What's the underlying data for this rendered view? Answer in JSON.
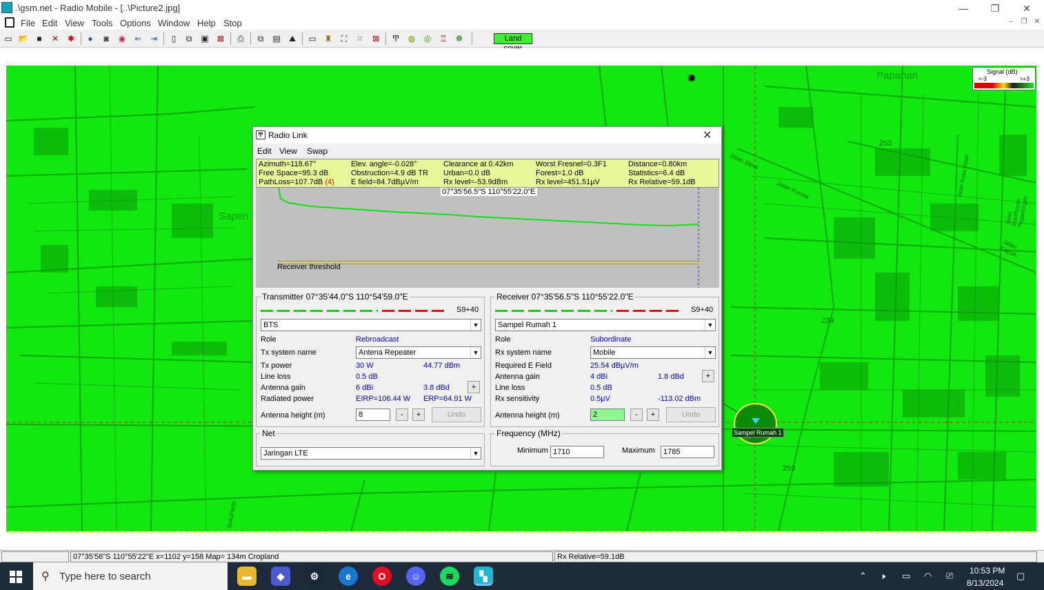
{
  "window": {
    "title": ".\\gsm.net - Radio Mobile - [..\\Picture2.jpg]",
    "controls": [
      "—",
      "❐",
      "✕"
    ]
  },
  "menubar": {
    "items": [
      "File",
      "Edit",
      "View",
      "Tools",
      "Options",
      "Window",
      "Help",
      "Stop"
    ],
    "mdi_controls": [
      "–",
      "❐",
      "✕"
    ]
  },
  "toolbar": {
    "land_cover_label": "Land cover"
  },
  "map": {
    "labels": {
      "papahan": "Papahan",
      "sapen": "Sapen",
      "jalan_bima": "Jalan Bima",
      "jalan_kurma": "Jalan Kurma",
      "jalan_nusa_indah": "Jalan Nusa Indah",
      "jalan_elamboyan": "Jalan Elamboyan Pegadungan",
      "jalan_kapuk": "Jalan Kapuk",
      "sukoharjo": "Sukoharjo",
      "km253a": "253",
      "km239": "239",
      "km253b": "253"
    },
    "rx_site_label": "Sampel Rumah 1",
    "colors": {
      "coverage": "#12e80f",
      "road": "#0da80b"
    }
  },
  "legend": {
    "title": "Signal (dB)",
    "min_label": "<-3",
    "max_label": ">+3"
  },
  "dialog": {
    "title": "Radio Link",
    "menu": [
      "Edit",
      "View",
      "Swap"
    ],
    "info": {
      "row1": [
        "Azimuth=118.67°",
        "Elev. angle=-0.028°",
        "Clearance at 0.42km",
        "Worst Fresnel=0.3F1",
        "Distance=0.80km"
      ],
      "row2": [
        "Free Space=95.3 dB",
        "Obstruction=4.9 dB TR",
        "Urban=0.0 dB",
        "Forest=1.0 dB",
        "Statistics=6.4 dB"
      ],
      "row3_pathloss": "PathLoss=107.7dB",
      "row3_pathloss_flag": "(4)",
      "row3": [
        "E field=84.7dBµV/m",
        "Rx level=-53.9dBm",
        "Rx level=451.51µV",
        "Rx Relative=59.1dB"
      ]
    },
    "profile": {
      "coord_label": "07°35'56.5\"S 110°55'22.0\"E",
      "threshold_label": "Receiver threshold"
    },
    "transmitter": {
      "group_label": "Transmitter 07°35'44.0\"S 110°54'59.0\"E",
      "meter_label": "S9+40",
      "unit": "BTS",
      "role_label": "Role",
      "role_value": "Rebroadcast",
      "system_label": "Tx system name",
      "system_value": "Antena Repeater",
      "power_label": "Tx power",
      "power_w": "30 W",
      "power_dbm": "44.77 dBm",
      "line_loss_label": "Line loss",
      "line_loss": "0.5 dB",
      "gain_label": "Antenna gain",
      "gain_dbi": "6 dBi",
      "gain_dbd": "3.8 dBd",
      "radiated_label": "Radiated power",
      "eirp": "EIRP=106.44 W",
      "erp": "ERP=64.91 W",
      "height_label": "Antenna height (m)",
      "height_value": "8",
      "minus": "-",
      "plus": "+",
      "undo": "Undo"
    },
    "receiver": {
      "group_label": "Receiver 07°35'56.5\"S 110°55'22.0\"E",
      "meter_label": "S9+40",
      "unit": "Sampel Rumah 1",
      "role_label": "Role",
      "role_value": "Subordinate",
      "system_label": "Rx system name",
      "system_value": "Mobile",
      "field_label": "Required E Field",
      "field_value": "25.54 dBµV/m",
      "gain_label": "Antenna gain",
      "gain_dbi": "4 dBi",
      "gain_dbd": "1.8 dBd",
      "line_loss_label": "Line loss",
      "line_loss": "0.5 dB",
      "sens_label": "Rx sensitivity",
      "sens_uv": "0.5µV",
      "sens_dbm": "-113.02 dBm",
      "height_label": "Antenna height (m)",
      "height_value": "2",
      "minus": "-",
      "plus": "+",
      "undo": "Undo"
    },
    "net": {
      "group_label": "Net",
      "value": "Jaringan LTE"
    },
    "frequency": {
      "group_label": "Frequency (MHz)",
      "min_label": "Minimum",
      "min_value": "1710",
      "max_label": "Maximum",
      "max_value": "1785"
    }
  },
  "statusbar": {
    "coords": "07°35'56\"S  110°55'22\"E    x=1102 y=158 Map= 134m Cropland",
    "rx_relative": "Rx Relative=59.1dB"
  },
  "taskbar": {
    "search_placeholder": "Type here to search",
    "time": "10:53 PM",
    "date": "8/13/2024"
  }
}
